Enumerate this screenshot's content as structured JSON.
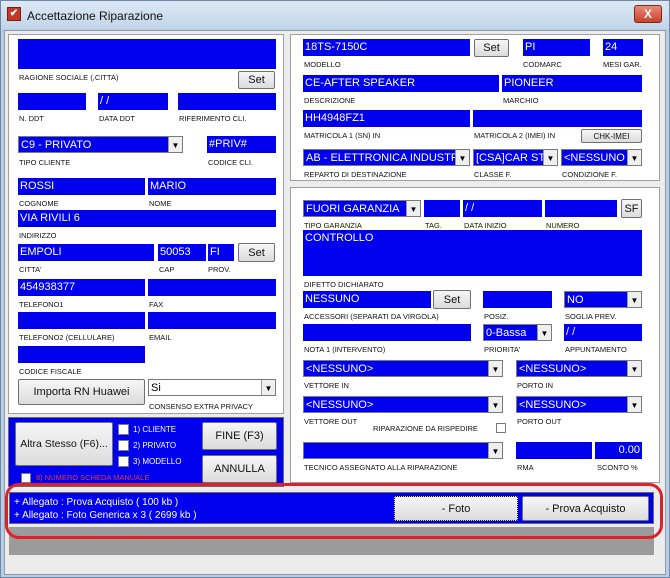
{
  "window": {
    "title": "Accettazione Riparazione",
    "close_label": "X",
    "icon_label": "✔"
  },
  "left": {
    "ragione_sociale": {
      "label": "RAGIONE SOCIALE (,CITTA)",
      "value": "",
      "set_label": "Set"
    },
    "n_ddt": {
      "label": "N. DDT",
      "value": ""
    },
    "data_ddt": {
      "label": "DATA DDT",
      "value": "  /  /"
    },
    "rif_cli": {
      "label": "RIFERIMENTO CLI.",
      "value": ""
    },
    "tipo_cliente": {
      "label": "TIPO CLIENTE",
      "value": "C9 - PRIVATO"
    },
    "codice_cli": {
      "label": "CODICE CLI.",
      "value": "#PRIV#"
    },
    "cognome": {
      "label": "COGNOME",
      "value": "ROSSI"
    },
    "nome": {
      "label": "NOME",
      "value": "MARIO"
    },
    "indirizzo": {
      "label": "INDIRIZZO",
      "value": "VIA RIVILI 6"
    },
    "citta": {
      "label": "CITTA'",
      "value": "EMPOLI"
    },
    "cap": {
      "label": "CAP",
      "value": "50053"
    },
    "prov": {
      "label": "PROV.",
      "value": "FI"
    },
    "set2_label": "Set",
    "telefono1": {
      "label": "TELEFONO1",
      "value": "454938377"
    },
    "fax": {
      "label": "FAX",
      "value": ""
    },
    "telefono2": {
      "label": "TELEFONO2 (CELLULARE)",
      "value": ""
    },
    "email": {
      "label": "EMAIL",
      "value": ""
    },
    "codice_fiscale": {
      "label": "CODICE FISCALE",
      "value": ""
    },
    "importa_label": "Importa RN Huawei",
    "consenso": {
      "label": "CONSENSO EXTRA PRIVACY",
      "value": "Si"
    }
  },
  "actions": {
    "altra_stesso": "Altra Stesso (F6)...",
    "cliente": "1) CLIENTE",
    "privato": "2) PRIVATO",
    "modello": "3) MODELLO",
    "fine": "FINE (F3)",
    "annulla": "ANNULLA",
    "numero_scheda": "8) NUMERO SCHEDA MANUALE"
  },
  "right": {
    "modello": {
      "label": "MODELLO",
      "value": "18TS-7150C",
      "set_label": "Set"
    },
    "codmarc": {
      "label": "CODMARC",
      "value": "PI"
    },
    "mesi_gar": {
      "label": "MESI GAR.",
      "value": "24"
    },
    "descrizione": {
      "label": "DESCRIZIONE",
      "value": "CE-AFTER SPEAKER"
    },
    "marchio": {
      "label": "MARCHIO",
      "value": "PIONEER"
    },
    "matricola1": {
      "label": "MATRICOLA 1 (SN) IN",
      "value": "HH4948FZ1"
    },
    "matricola2": {
      "label": "MATRICOLA 2 (IMEI) IN",
      "value": ""
    },
    "chk_imei": "CHK-IMEI",
    "reparto": {
      "label": "REPARTO DI DESTINAZIONE",
      "value": "AB - ELETTRONICA INDUSTF"
    },
    "classe": {
      "label": "CLASSE F.",
      "value": "[CSA]CAR ST"
    },
    "condizione": {
      "label": "CONDIZIONE F.",
      "value": "<NESSUNO"
    },
    "tipo_garanzia": {
      "label": "TIPO GARANZIA",
      "value": "FUORI GARANZIA"
    },
    "tag": {
      "label": "TAG.",
      "value": ""
    },
    "data_inizio": {
      "label": "DATA INIZIO",
      "value": "  /  /"
    },
    "numero": {
      "label": "NUMERO",
      "value": ""
    },
    "sf_label": "SF",
    "difetto": {
      "label": "DIFETTO DICHIARATO",
      "value": "CONTROLLO"
    },
    "accessori": {
      "label": "ACCESSORI (SEPARATI DA VIRGOLA)",
      "value": "NESSUNO",
      "set_label": "Set"
    },
    "posiz": {
      "label": "POSIZ.",
      "value": ""
    },
    "soglia": {
      "label": "SOGLIA PREV.",
      "value": "NO"
    },
    "nota1": {
      "label": "NOTA 1 (INTERVENTO)",
      "value": ""
    },
    "priorita": {
      "label": "PRIORITA'",
      "value": "0-Bassa"
    },
    "appuntamento": {
      "label": "APPUNTAMENTO",
      "value": "  /  /"
    },
    "vettore_in": {
      "label": "VETTORE IN",
      "value": "<NESSUNO>"
    },
    "porto_in": {
      "label": "PORTO IN",
      "value": "<NESSUNO>"
    },
    "vettore_out": {
      "label": "VETTORE OUT",
      "value": "<NESSUNO>"
    },
    "riparazione_da_rispedire": "RIPARAZIONE DA RISPEDIRE",
    "porto_out": {
      "label": "PORTO OUT",
      "value": "<NESSUNO>"
    },
    "tecnico": {
      "label": "TECNICO ASSEGNATO ALLA RIPARAZIONE",
      "value": ""
    },
    "rma": {
      "label": "RMA",
      "value": ""
    },
    "sconto": {
      "label": "SCONTO %",
      "value": "0.00"
    }
  },
  "attachments": {
    "lines": [
      "+ Allegato : Prova Acquisto ( 100 kb )",
      "+ Allegato : Foto Generica x 3 ( 2699 kb )"
    ],
    "foto_button": "- Foto",
    "prova_button": "- Prova Acquisto"
  },
  "colors": {
    "field_blue": "#0000ee",
    "highlight_red": "#d9232a"
  }
}
